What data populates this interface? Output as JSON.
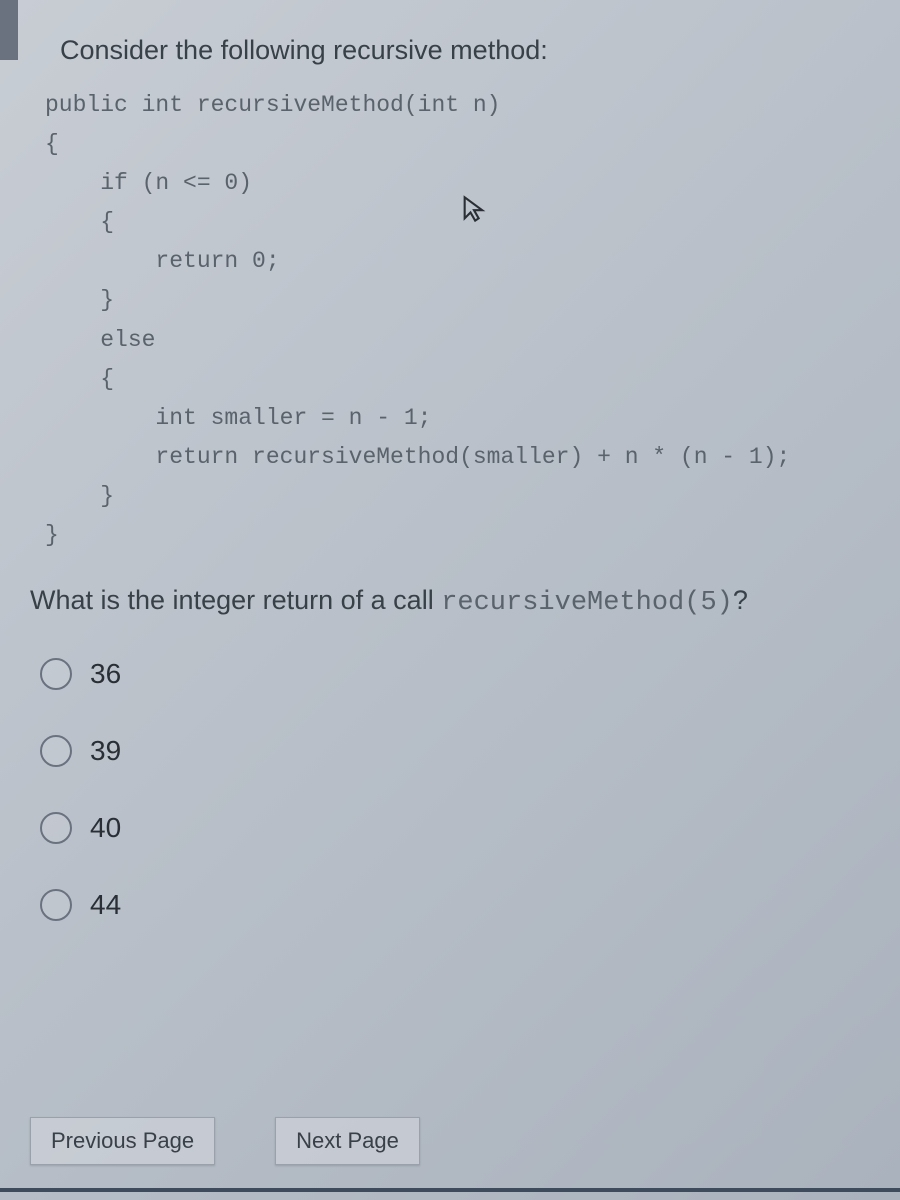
{
  "prompt": "Consider the following recursive method:",
  "code_lines": [
    "public int recursiveMethod(int n)",
    "{",
    "    if (n <= 0)",
    "    {",
    "        return 0;",
    "    }",
    "    else",
    "    {",
    "        int smaller = n - 1;",
    "        return recursiveMethod(smaller) + n * (n - 1);",
    "    }",
    "}"
  ],
  "question_tail_pre": "What is the integer return of a call ",
  "question_tail_mono": "recursiveMethod(5)",
  "question_tail_post": "?",
  "options": [
    "36",
    "39",
    "40",
    "44"
  ],
  "nav": {
    "prev": "Previous Page",
    "next": "Next Page"
  }
}
